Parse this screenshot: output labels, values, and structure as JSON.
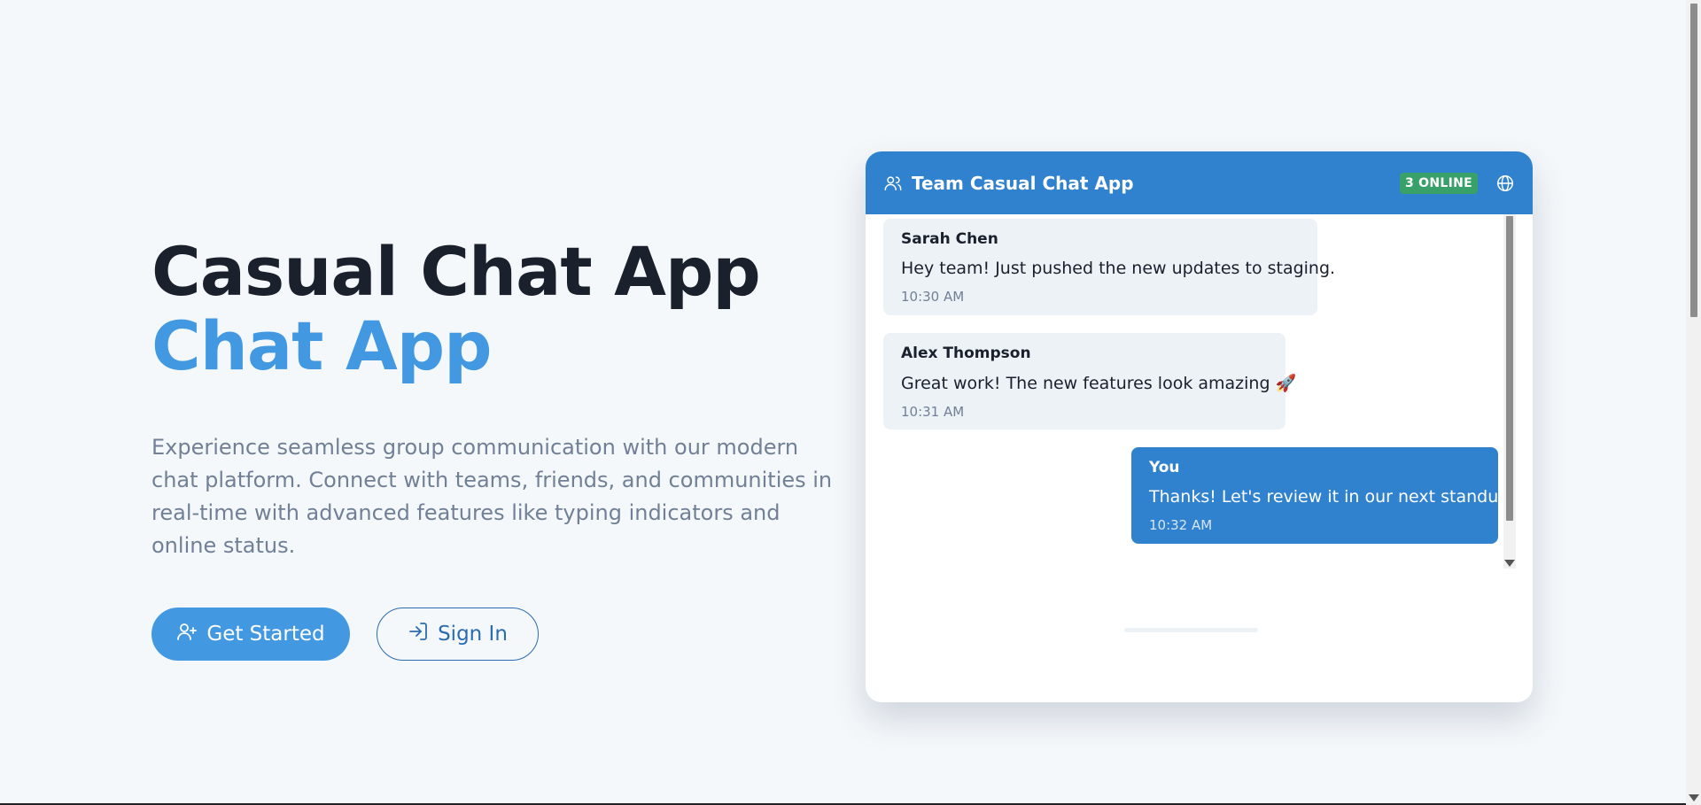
{
  "hero": {
    "title_line1": "Casual Chat App",
    "title_line2": "Chat App",
    "description": "Experience seamless group communication with our modern chat platform. Connect with teams, friends, and communities in real-time with advanced features like typing indicators and online status.",
    "get_started_label": "Get Started",
    "sign_in_label": "Sign In"
  },
  "chat": {
    "title": "Team Casual Chat App",
    "online_badge": "3 ONLINE",
    "messages": [
      {
        "author": "Sarah Chen",
        "text": "Hey team! Just pushed the new updates to staging.",
        "time": "10:30 AM"
      },
      {
        "author": "Alex Thompson",
        "text": "Great work! The new features look amazing 🚀",
        "time": "10:31 AM"
      },
      {
        "author": "You",
        "text": "Thanks! Let's review it in our next standup.",
        "time": "10:32 AM"
      }
    ]
  },
  "colors": {
    "accent": "#4299e1",
    "header": "#3182ce",
    "online": "#38a169"
  },
  "icons": [
    "user-plus-icon",
    "sign-in-icon",
    "users-icon",
    "globe-icon"
  ]
}
